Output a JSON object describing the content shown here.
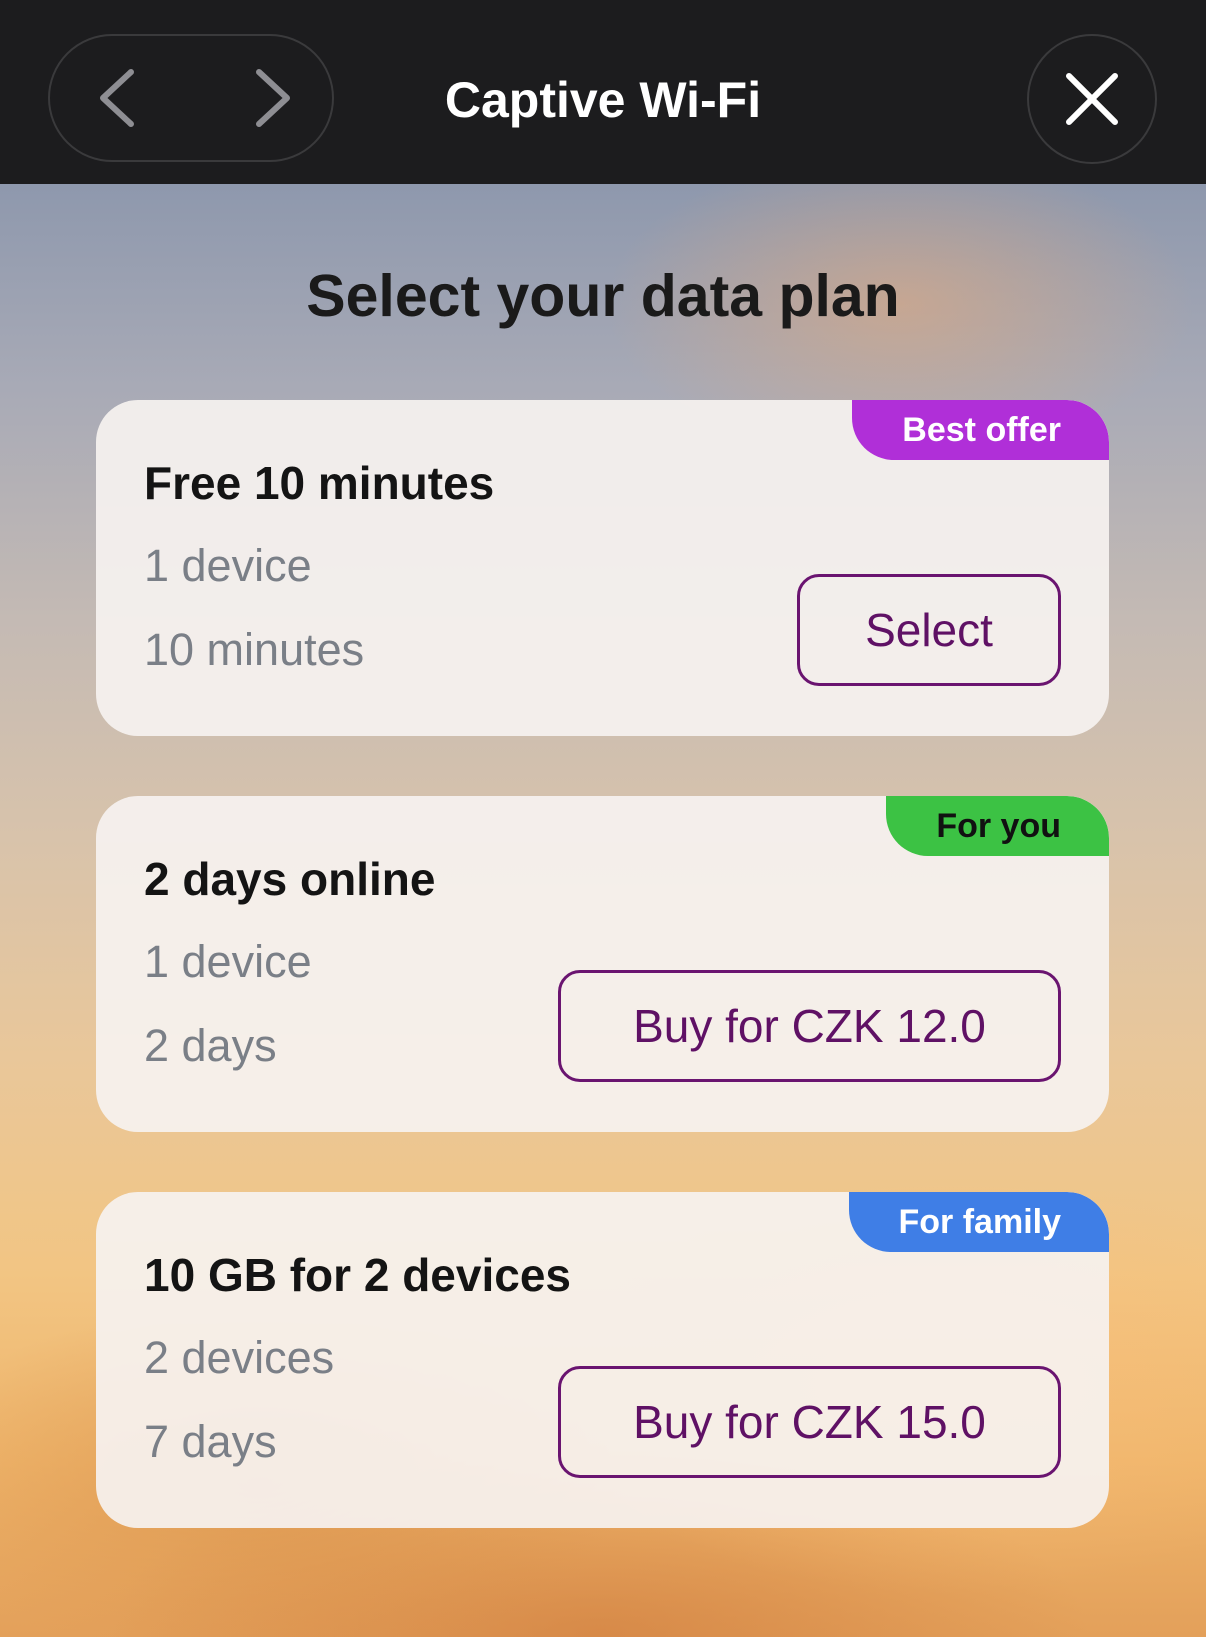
{
  "header": {
    "title": "Captive Wi-Fi"
  },
  "page": {
    "heading": "Select your data plan"
  },
  "colors": {
    "accent": "#6a1470",
    "badge_best_offer": "#b02fd8",
    "badge_for_you": "#3cc244",
    "badge_for_family": "#3f7ee6"
  },
  "plans": [
    {
      "badge": "Best offer",
      "title": "Free 10 minutes",
      "devices": "1 device",
      "duration": "10 minutes",
      "button_label": "Select"
    },
    {
      "badge": "For you",
      "title": "2 days online",
      "devices": "1 device",
      "duration": "2 days",
      "button_label": "Buy for CZK 12.0"
    },
    {
      "badge": "For family",
      "title": "10 GB for 2 devices",
      "devices": "2 devices",
      "duration": "7 days",
      "button_label": "Buy for CZK 15.0"
    }
  ]
}
